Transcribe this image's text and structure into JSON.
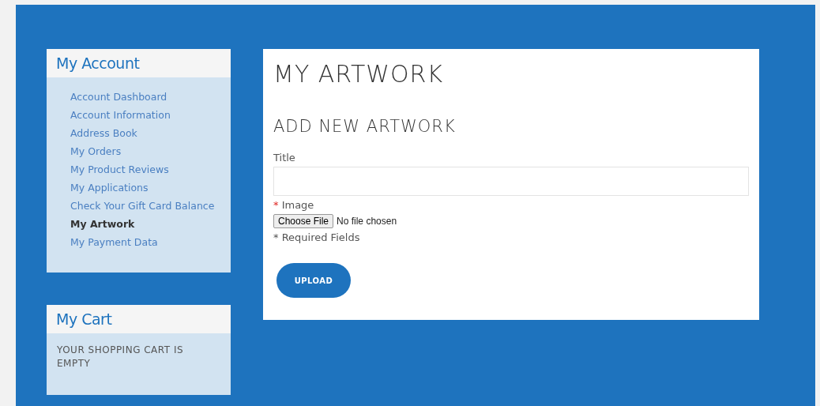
{
  "sidebar": {
    "account": {
      "title": "My Account",
      "items": [
        {
          "label": "Account Dashboard",
          "selected": false
        },
        {
          "label": "Account Information",
          "selected": false
        },
        {
          "label": "Address Book",
          "selected": false
        },
        {
          "label": "My Orders",
          "selected": false
        },
        {
          "label": "My Product Reviews",
          "selected": false
        },
        {
          "label": "My Applications",
          "selected": false
        },
        {
          "label": "Check Your Gift Card Balance",
          "selected": false
        },
        {
          "label": "My Artwork",
          "selected": true
        },
        {
          "label": "My Payment Data",
          "selected": false
        }
      ]
    },
    "cart": {
      "title": "My Cart",
      "message": "YOUR SHOPPING CART IS EMPTY"
    }
  },
  "main": {
    "title": "MY ARTWORK",
    "subtitle": "ADD NEW ARTWORK",
    "fields": [
      {
        "kind": "text",
        "label": "Title"
      },
      {
        "kind": "file",
        "label": "Image",
        "required_mark": "*",
        "button": "Choose File",
        "value": "No file chosen"
      }
    ],
    "required_note": "* Required Fields",
    "submit": "UPLOAD"
  }
}
